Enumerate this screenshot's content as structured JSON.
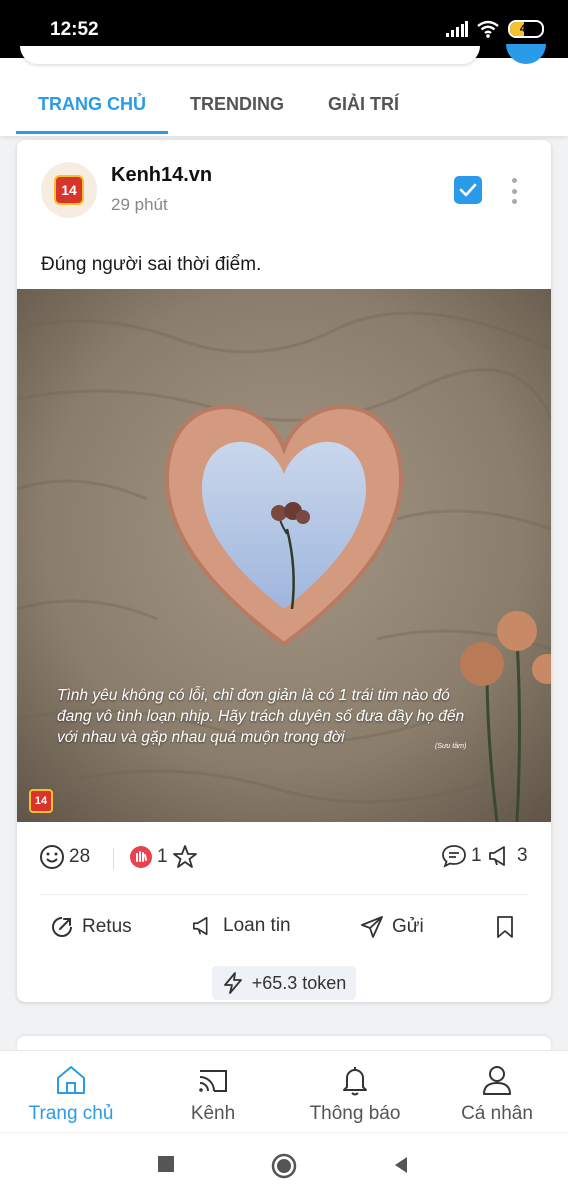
{
  "status_bar": {
    "time": "12:52",
    "battery": "45",
    "battery_level_percent": 45
  },
  "tabs": [
    {
      "label": "TRANG CHỦ",
      "active": true
    },
    {
      "label": "TRENDING",
      "active": false
    },
    {
      "label": "GIẢI TRÍ",
      "active": false
    }
  ],
  "post": {
    "source": "Kenh14.vn",
    "logo_text": "14",
    "time": "29 phút",
    "text": "Đúng người sai thời điểm.",
    "image": {
      "caption": "Tình yêu không có lỗi, chỉ đơn giản là có 1 trái tim nào đó đang vô tình loạn nhịp. Hãy trách duyên số đưa đầy họ đến với nhau và gặp nhau quá muộn trong đời",
      "credit": "(Sưu tầm)",
      "logo_text": "14"
    },
    "stats": {
      "smile_count": "28",
      "clap_count": "1",
      "comment_count": "1",
      "share_count": "3"
    },
    "actions": {
      "retus": "Retus",
      "loan_tin": "Loan tin",
      "gui": "Gửi"
    },
    "token": "+65.3 token"
  },
  "bottom_nav": [
    {
      "label": "Trang chủ",
      "icon": "home-icon",
      "active": true
    },
    {
      "label": "Kênh",
      "icon": "cast-icon",
      "active": false
    },
    {
      "label": "Thông báo",
      "icon": "bell-icon",
      "active": false
    },
    {
      "label": "Cá nhân",
      "icon": "user-icon",
      "active": false
    }
  ],
  "colors": {
    "accent": "#2a9be8",
    "brand_red": "#d8342a",
    "brand_yellow": "#f5c030"
  }
}
